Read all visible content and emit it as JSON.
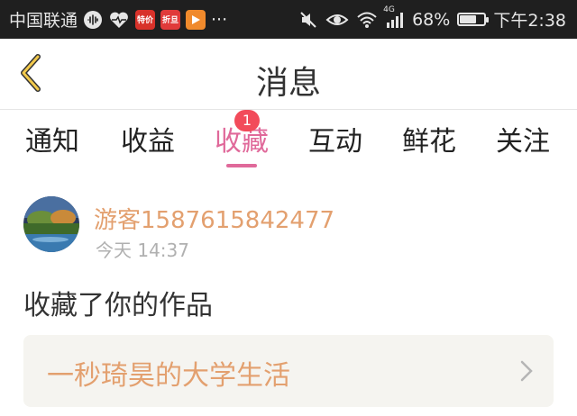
{
  "status_bar": {
    "carrier": "中国联通",
    "app_badges": [
      "特价",
      "折旦"
    ],
    "network": "4G",
    "battery_percent": "68%",
    "battery_level": 0.68,
    "time": "下午2:38",
    "more": "···"
  },
  "header": {
    "title": "消息"
  },
  "tabs": [
    {
      "label": "通知",
      "active": false,
      "badge": ""
    },
    {
      "label": "收益",
      "active": false,
      "badge": ""
    },
    {
      "label": "收藏",
      "active": true,
      "badge": "1"
    },
    {
      "label": "互动",
      "active": false,
      "badge": ""
    },
    {
      "label": "鲜花",
      "active": false,
      "badge": ""
    },
    {
      "label": "关注",
      "active": false,
      "badge": ""
    }
  ],
  "message": {
    "username": "游客1587615842477",
    "timestamp": "今天 14:37",
    "action": "收藏了你的作品",
    "work_title": "一秒琦昊的大学生活"
  },
  "colors": {
    "accent": "#e0699a",
    "username": "#e3a06f",
    "badge": "#f24b5a"
  }
}
